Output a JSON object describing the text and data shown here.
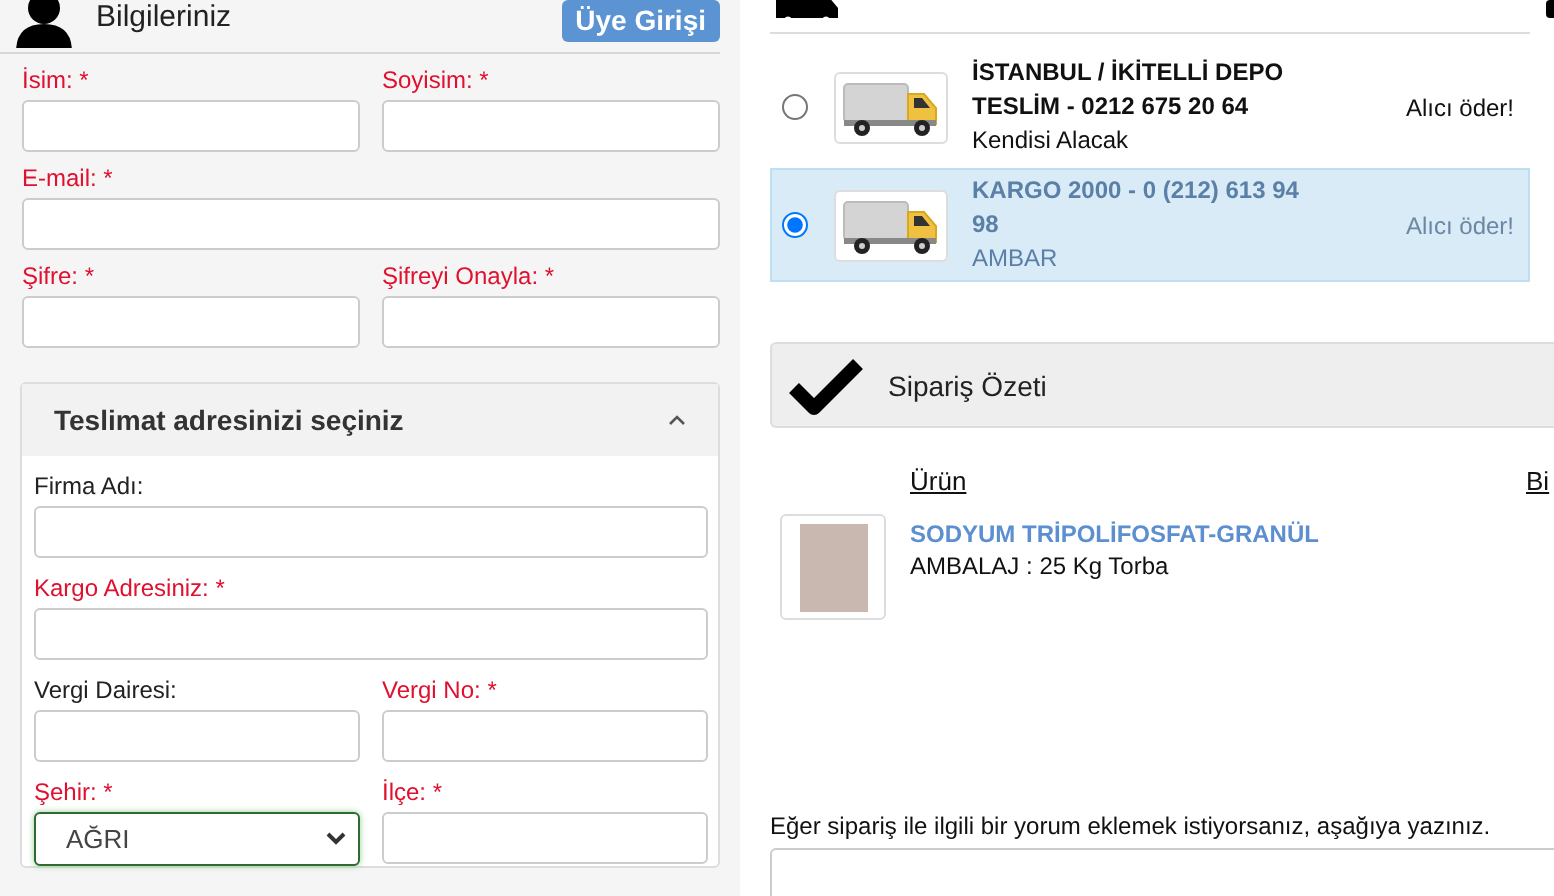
{
  "header": {
    "title": "Bilgileriniz",
    "login_button": "Üye Girişi"
  },
  "personal_rows": [
    [
      {
        "label": "İsim: *",
        "required": true,
        "kind": "text"
      },
      {
        "label": "Soyisim: *",
        "required": true,
        "kind": "text"
      }
    ],
    [
      {
        "label": "E-mail: *",
        "required": true,
        "kind": "text"
      }
    ],
    [
      {
        "label": "Şifre: *",
        "required": true,
        "kind": "text"
      },
      {
        "label": "Şifreyi Onayla: *",
        "required": true,
        "kind": "text"
      }
    ]
  ],
  "address_panel": {
    "title": "Teslimat adresinizi seçiniz",
    "expanded": true,
    "rows": [
      [
        {
          "label": "Firma Adı:",
          "required": false,
          "kind": "text"
        }
      ],
      [
        {
          "label": "Kargo Adresiniz: *",
          "required": true,
          "kind": "text"
        }
      ],
      [
        {
          "label": "Vergi Dairesi:",
          "required": false,
          "kind": "text"
        },
        {
          "label": "Vergi No: *",
          "required": true,
          "kind": "text"
        }
      ],
      [
        {
          "label": "Şehir: *",
          "required": true,
          "kind": "select",
          "value": "AĞRI",
          "focused": true
        },
        {
          "label": "İlçe: *",
          "required": true,
          "kind": "text"
        }
      ]
    ]
  },
  "shipping_options": [
    {
      "title": "İSTANBUL / İKİTELLİ DEPO TESLİM - 0212 675 20 64",
      "subtitle": "Kendisi Alacak",
      "price": "Alıcı öder!",
      "selected": false
    },
    {
      "title": "KARGO 2000 - 0 (212) 613 94 98",
      "subtitle": "AMBAR",
      "price": "Alıcı öder!",
      "selected": true
    }
  ],
  "order_summary": {
    "title": "Sipariş Özeti",
    "columns": [
      "Ürün",
      "Bi"
    ],
    "items": [
      {
        "name": "SODYUM TRİPOLİFOSFAT-GRANÜL",
        "detail": "AMBALAJ : 25 Kg Torba"
      }
    ]
  },
  "comment": {
    "prompt": "Eğer sipariş ile ilgili bir yorum eklemek istiyorsanız, aşağıya yazınız."
  }
}
